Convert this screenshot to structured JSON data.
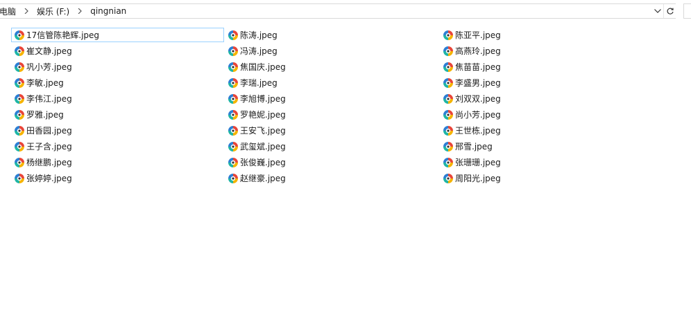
{
  "address_bar": {
    "crumbs": [
      "电脑",
      "娱乐 (F:)",
      "qingnian"
    ],
    "dropdown_icon": "chevron-down-icon",
    "refresh_icon": "refresh-icon"
  },
  "files": [
    {
      "name": "17信管陈艳辉.jpeg",
      "selected": true
    },
    {
      "name": "崔文静.jpeg"
    },
    {
      "name": "巩小芳.jpeg"
    },
    {
      "name": "李敏.jpeg"
    },
    {
      "name": "李伟江.jpeg"
    },
    {
      "name": "罗雅.jpeg"
    },
    {
      "name": "田香园.jpeg"
    },
    {
      "name": "王子含.jpeg"
    },
    {
      "name": "杨继鹏.jpeg"
    },
    {
      "name": "张婷婷.jpeg"
    },
    {
      "name": "陈涛.jpeg"
    },
    {
      "name": "冯涛.jpeg"
    },
    {
      "name": "焦国庆.jpeg"
    },
    {
      "name": "李瑞.jpeg"
    },
    {
      "name": "李旭博.jpeg"
    },
    {
      "name": "罗艳妮.jpeg"
    },
    {
      "name": "王安飞.jpeg"
    },
    {
      "name": "武玺斌.jpeg"
    },
    {
      "name": "张俊巍.jpeg"
    },
    {
      "name": "赵继豪.jpeg"
    },
    {
      "name": "陈亚平.jpeg"
    },
    {
      "name": "高燕玲.jpeg"
    },
    {
      "name": "焦苗苗.jpeg"
    },
    {
      "name": "李盛男.jpeg"
    },
    {
      "name": "刘双双.jpeg"
    },
    {
      "name": "尚小芳.jpeg"
    },
    {
      "name": "王世栋.jpeg"
    },
    {
      "name": "邢雪.jpeg"
    },
    {
      "name": "张珊珊.jpeg"
    },
    {
      "name": "周阳光.jpeg"
    }
  ],
  "file_icon": "image-file-icon",
  "colors": {
    "selection_border": "#99d1ff",
    "icon_red": "#e8463a",
    "icon_teal": "#1fb5a6",
    "icon_yellow": "#f5b400",
    "icon_blue": "#2d7fd3"
  }
}
